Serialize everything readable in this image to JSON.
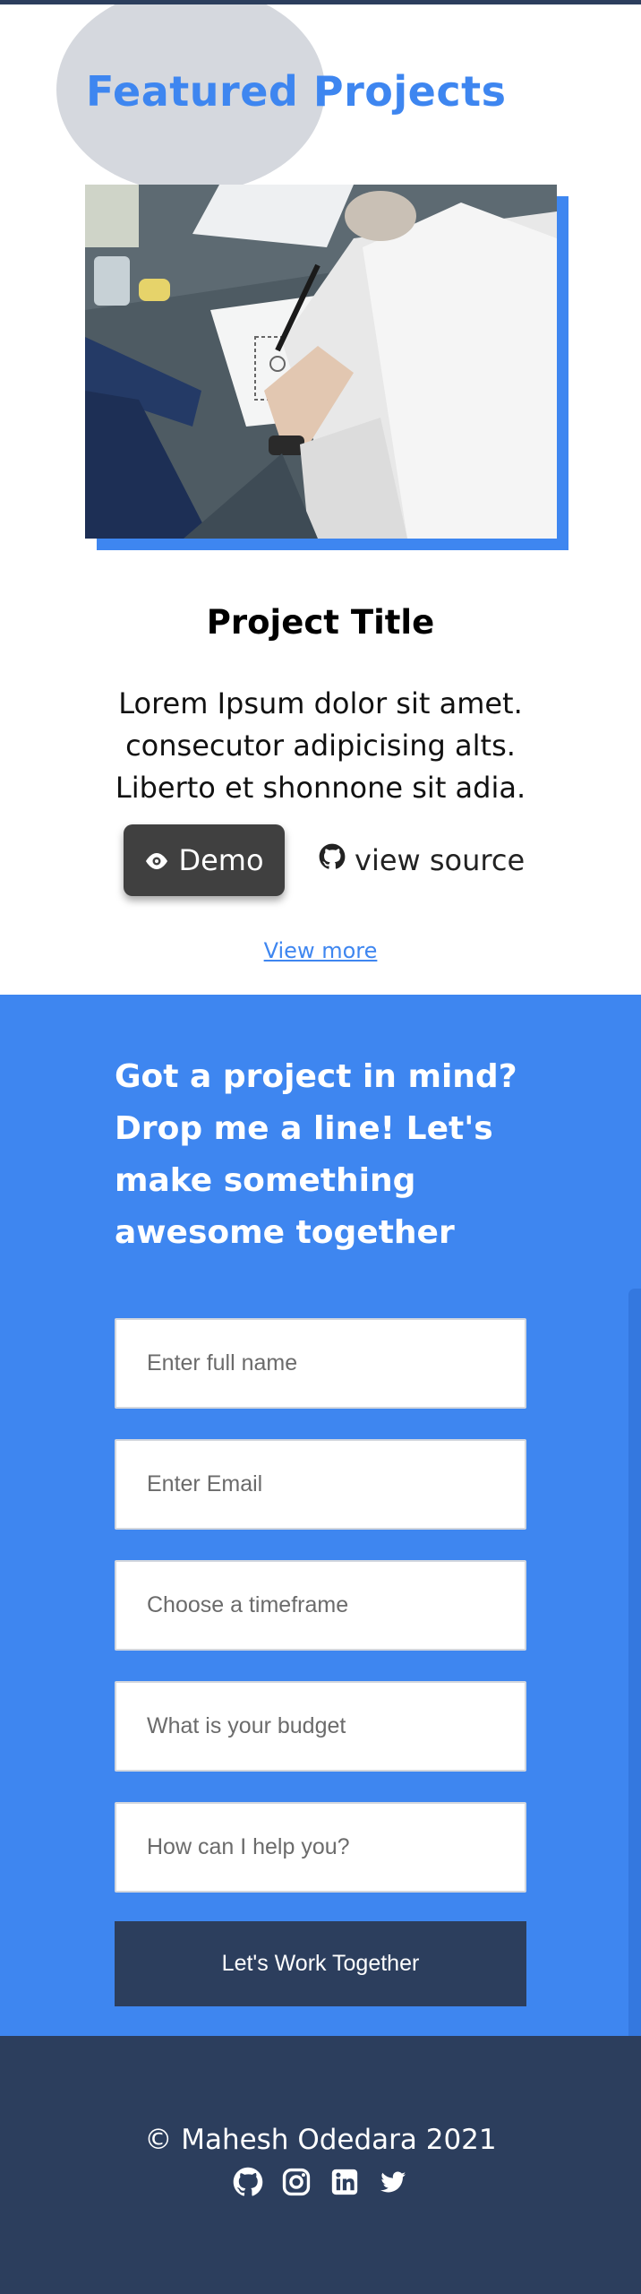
{
  "featured": {
    "title": "Featured Projects",
    "project": {
      "title": "Project Title",
      "description": "Lorem Ipsum dolor sit amet. consecutor adipicising alts. Liberto et shonnone sit adia.",
      "demo_label": "Demo",
      "source_label": "view source"
    },
    "view_more": "View more"
  },
  "contact": {
    "heading": "Got a project in mind? Drop me a line! Let's make something awesome together",
    "fields": {
      "name_placeholder": "Enter full name",
      "email_placeholder": "Enter Email",
      "timeframe_placeholder": "Choose a timeframe",
      "budget_placeholder": "What is your budget",
      "message_placeholder": "How can I help you?"
    },
    "submit_label": "Let's Work Together"
  },
  "footer": {
    "copyright": "© Mahesh Odedara 2021",
    "socials": [
      "github-icon",
      "instagram-icon",
      "linkedin-icon",
      "twitter-icon"
    ]
  },
  "colors": {
    "accent": "#3e86f0",
    "navy": "#2c3e5d",
    "button_dark": "#404040"
  }
}
